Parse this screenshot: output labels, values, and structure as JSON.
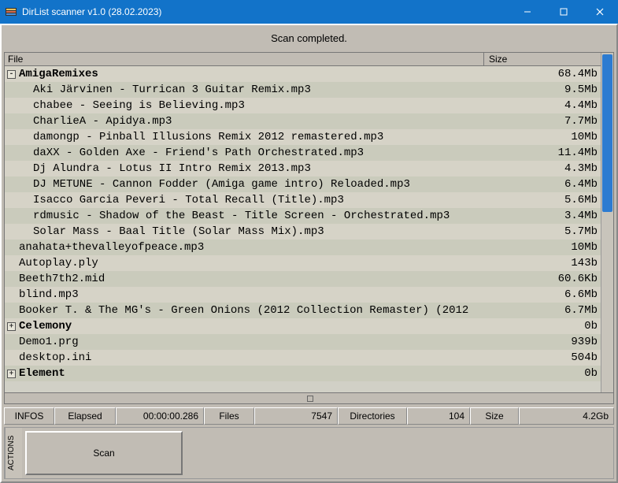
{
  "window": {
    "title": "DirList scanner v1.0 (28.02.2023)"
  },
  "status_message": "Scan completed.",
  "columns": {
    "file": "File",
    "size": "Size"
  },
  "rows": [
    {
      "kind": "dir",
      "indent": 0,
      "expander": "-",
      "name": "AmigaRemixes",
      "size": "68.4Mb",
      "bold": true
    },
    {
      "kind": "file",
      "indent": 2,
      "name": "Aki Järvinen - Turrican 3 Guitar Remix.mp3",
      "size": "9.5Mb"
    },
    {
      "kind": "file",
      "indent": 2,
      "name": "chabee - Seeing is Believing.mp3",
      "size": "4.4Mb"
    },
    {
      "kind": "file",
      "indent": 2,
      "name": "CharlieA - Apidya.mp3",
      "size": "7.7Mb"
    },
    {
      "kind": "file",
      "indent": 2,
      "name": "damongp - Pinball Illusions Remix 2012 remastered.mp3",
      "size": "10Mb"
    },
    {
      "kind": "file",
      "indent": 2,
      "name": "daXX - Golden Axe - Friend's Path Orchestrated.mp3",
      "size": "11.4Mb"
    },
    {
      "kind": "file",
      "indent": 2,
      "name": "Dj Alundra - Lotus II Intro Remix 2013.mp3",
      "size": "4.3Mb"
    },
    {
      "kind": "file",
      "indent": 2,
      "name": "DJ METUNE - Cannon Fodder (Amiga game intro) Reloaded.mp3",
      "size": "6.4Mb"
    },
    {
      "kind": "file",
      "indent": 2,
      "name": "Isacco Garcia Peveri - Total Recall (Title).mp3",
      "size": "5.6Mb"
    },
    {
      "kind": "file",
      "indent": 2,
      "name": "rdmusic - Shadow of the Beast - Title Screen - Orchestrated.mp3",
      "size": "3.4Mb"
    },
    {
      "kind": "file",
      "indent": 2,
      "name": "Solar Mass - Baal Title (Solar Mass Mix).mp3",
      "size": "5.7Mb"
    },
    {
      "kind": "file",
      "indent": 1,
      "name": "anahata+thevalleyofpeace.mp3",
      "size": "10Mb"
    },
    {
      "kind": "file",
      "indent": 1,
      "name": "Autoplay.ply",
      "size": "143b"
    },
    {
      "kind": "file",
      "indent": 1,
      "name": "Beeth7th2.mid",
      "size": "60.6Kb"
    },
    {
      "kind": "file",
      "indent": 1,
      "name": "blind.mp3",
      "size": "6.6Mb"
    },
    {
      "kind": "file",
      "indent": 1,
      "name": "Booker T. & The MG's - Green Onions (2012 Collection Remaster) (2012",
      "size": "6.7Mb"
    },
    {
      "kind": "dir",
      "indent": 0,
      "expander": "+",
      "name": "Celemony",
      "size": "0b",
      "bold": true
    },
    {
      "kind": "file",
      "indent": 1,
      "name": "Demo1.prg",
      "size": "939b"
    },
    {
      "kind": "file",
      "indent": 1,
      "name": "desktop.ini",
      "size": "504b"
    },
    {
      "kind": "dir",
      "indent": 0,
      "expander": "+",
      "name": "Element",
      "size": "0b",
      "bold": true
    }
  ],
  "info": {
    "infos_label": "INFOS",
    "elapsed_label": "Elapsed",
    "elapsed_value": "00:00:00.286",
    "files_label": "Files",
    "files_value": "7547",
    "dirs_label": "Directories",
    "dirs_value": "104",
    "size_label": "Size",
    "size_value": "4.2Gb"
  },
  "actions": {
    "tab_label": "ACTIONS",
    "scan_label": "Scan"
  }
}
